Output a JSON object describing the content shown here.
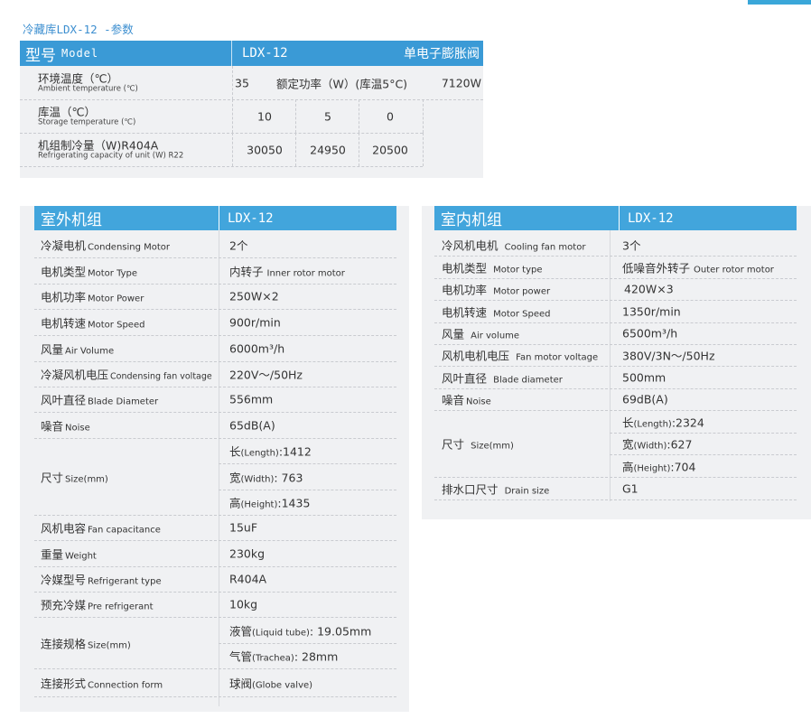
{
  "page_title": "冷藏库LDX-12 -参数",
  "top_table": {
    "header": {
      "model_cn": "型号",
      "model_en": "Model",
      "model_value": "LDX-12",
      "valve_type": "单电子膨胀阀"
    },
    "ambient": {
      "cn": "环境温度（℃）",
      "en": "Ambient temperature (℃)",
      "value": "35",
      "power_label": "额定功率（W）(库温5°C)",
      "power_value": "7120W"
    },
    "storage": {
      "cn": "库温（℃）",
      "en": "Storage temperature (℃)",
      "values": [
        "10",
        "5",
        "0"
      ]
    },
    "capacity": {
      "cn": "机组制冷量（W)R404A",
      "en": "Refrigerating capacity of unit (W) R22",
      "values": [
        "30050",
        "24950",
        "20500"
      ]
    }
  },
  "outdoor": {
    "title": "室外机组",
    "model": "LDX-12",
    "rows": [
      {
        "cn": "冷凝电机",
        "en": "Condensing Motor",
        "value": "2个"
      },
      {
        "cn": "电机类型",
        "en": "Motor Type",
        "value_cn": "内转子",
        "value_en": "Inner rotor motor"
      },
      {
        "cn": "电机功率",
        "en": "Motor Power",
        "value": "250W×2"
      },
      {
        "cn": "电机转速",
        "en": "Motor Speed",
        "value": "900r/min"
      },
      {
        "cn": "风量",
        "en": "Air Volume",
        "value": "6000m³/h"
      },
      {
        "cn": "冷凝风机电压",
        "en": "Condensing fan voltage",
        "value": "220V～/50Hz"
      },
      {
        "cn": "风叶直径",
        "en": "Blade Diameter",
        "value": "556mm"
      },
      {
        "cn": "噪音",
        "en": "Noise",
        "value": "65dB(A)"
      }
    ],
    "size": {
      "cn": "尺寸",
      "en": "Size(mm)",
      "length_cn": "长",
      "length_en": "(Length)",
      "length_val": ":1412",
      "width_cn": "宽",
      "width_en": "(Width)",
      "width_val": ": 763",
      "height_cn": "高",
      "height_en": "(Height)",
      "height_val": ":1435"
    },
    "rows2": [
      {
        "cn": "风机电容",
        "en": "Fan capacitance",
        "value": "15uF"
      },
      {
        "cn": "重量",
        "en": "Weight",
        "value": "230kg"
      },
      {
        "cn": "冷媒型号",
        "en": "Refrigerant type",
        "value": "R404A"
      },
      {
        "cn": "预充冷媒",
        "en": "Pre refrigerant",
        "value": "10kg"
      }
    ],
    "connection_size": {
      "cn": "连接规格",
      "en": "Size(mm)",
      "liquid_cn": "液管",
      "liquid_en": "(Liquid tube)",
      "liquid_val": ":  19.05mm",
      "gas_cn": "气管",
      "gas_en": "(Trachea)",
      "gas_val": ":  28mm"
    },
    "connection_form": {
      "cn": "连接形式",
      "en": "Connection form",
      "value_cn": "球阀",
      "value_en": "(Globe valve)"
    }
  },
  "indoor": {
    "title": "室内机组",
    "model": "LDX-12",
    "rows": [
      {
        "cn": "冷风机电机",
        "en": "Cooling fan motor",
        "value": "3个"
      },
      {
        "cn": "电机类型",
        "en": "Motor type",
        "value_cn": "低噪音外转子",
        "value_en": "Outer rotor motor"
      },
      {
        "cn": "电机功率",
        "en": "Motor power",
        "value": "420W×3"
      },
      {
        "cn": "电机转速",
        "en": "Motor Speed",
        "value": "1350r/min"
      },
      {
        "cn": "风量",
        "en": "Air volume",
        "value": "6500m³/h"
      },
      {
        "cn": "风机电机电压",
        "en": "Fan motor voltage",
        "value": "380V/3N～/50Hz"
      },
      {
        "cn": "风叶直径",
        "en": "Blade diameter",
        "value": "500mm"
      },
      {
        "cn": "噪音",
        "en": "Noise",
        "value": "69dB(A)"
      }
    ],
    "size": {
      "cn": "尺寸",
      "en": "Size(mm)",
      "length_cn": "长",
      "length_en": "(Length)",
      "length_val": ":2324",
      "width_cn": "宽",
      "width_en": "(Width)",
      "width_val": ":627",
      "height_cn": "高",
      "height_en": "(Height)",
      "height_val": ":704"
    },
    "drain": {
      "cn": "排水口尺寸",
      "en": "Drain size",
      "value": "G1"
    }
  }
}
